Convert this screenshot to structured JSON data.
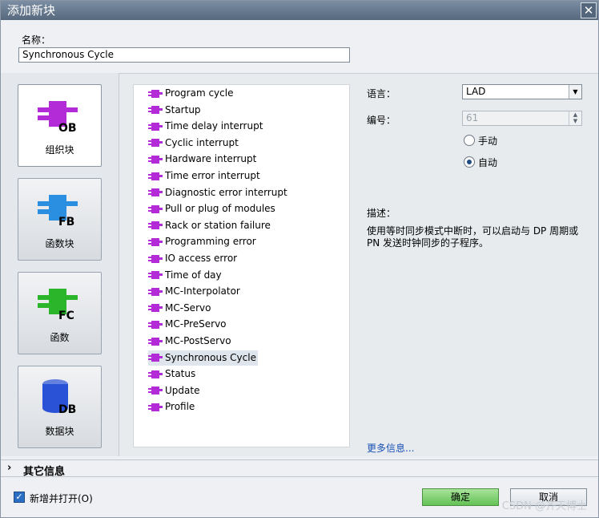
{
  "window": {
    "title": "添加新块",
    "close_label": "✕"
  },
  "name": {
    "label": "名称：",
    "value": "Synchronous Cycle"
  },
  "block_types": [
    {
      "label": "组织块",
      "tag": "OB",
      "color": "#b22bd6",
      "selected": true
    },
    {
      "label": "函数块",
      "tag": "FB",
      "color": "#2a8fe0",
      "selected": false
    },
    {
      "label": "函数",
      "tag": "FC",
      "color": "#2ab52a",
      "selected": false
    },
    {
      "label": "数据块",
      "tag": "DB",
      "color": "#2a52d6",
      "selected": false
    }
  ],
  "ob_list": [
    "Program cycle",
    "Startup",
    "Time delay interrupt",
    "Cyclic interrupt",
    "Hardware interrupt",
    "Time error interrupt",
    "Diagnostic error interrupt",
    "Pull or plug of modules",
    "Rack or station failure",
    "Programming error",
    "IO access error",
    "Time of day",
    "MC-Interpolator",
    "MC-Servo",
    "MC-PreServo",
    "MC-PostServo",
    "Synchronous Cycle",
    "Status",
    "Update",
    "Profile"
  ],
  "selected_index": 16,
  "props": {
    "language_label": "语言：",
    "language_value": "LAD",
    "number_label": "编号：",
    "number_value": "61",
    "manual_label": "手动",
    "auto_label": "自动",
    "description_label": "描述：",
    "description_text": "使用等时同步模式中断时，可以启动与 DP 周期或 PN 发送时钟同步的子程序。",
    "more_info": "更多信息..."
  },
  "other_info": {
    "chevron": "›",
    "label": "其它信息"
  },
  "footer": {
    "open_label": "新增并打开(O)",
    "ok_label": "确定",
    "cancel_label": "取消",
    "watermark": "CSDN @齐天博士"
  }
}
